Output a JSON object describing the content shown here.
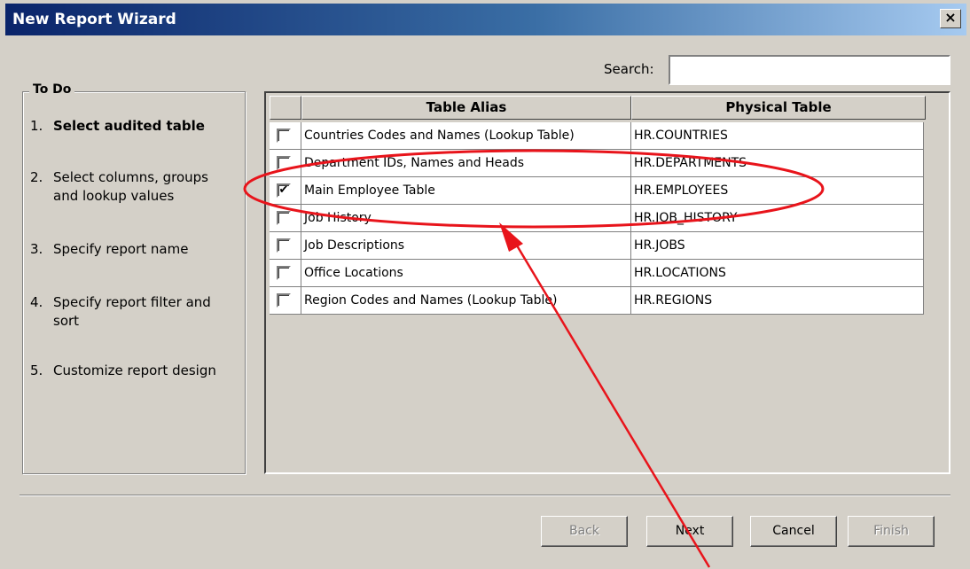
{
  "window": {
    "title": "New Report Wizard",
    "close_glyph": "×"
  },
  "search": {
    "label": "Search:",
    "value": "",
    "placeholder": ""
  },
  "todo": {
    "title": "To Do",
    "steps": [
      {
        "num": "1.",
        "label": "Select audited table",
        "active": true
      },
      {
        "num": "2.",
        "label": "Select columns, groups and lookup values",
        "active": false
      },
      {
        "num": "3.",
        "label": "Specify report name",
        "active": false
      },
      {
        "num": "4.",
        "label": "Specify report filter and sort",
        "active": false
      },
      {
        "num": "5.",
        "label": "Customize report design",
        "active": false
      }
    ]
  },
  "table": {
    "columns": [
      "Table Alias",
      "Physical Table"
    ],
    "rows": [
      {
        "checked": false,
        "alias": "Countries Codes and Names (Lookup Table)",
        "physical": "HR.COUNTRIES"
      },
      {
        "checked": false,
        "alias": "Department IDs, Names and Heads",
        "physical": "HR.DEPARTMENTS"
      },
      {
        "checked": true,
        "alias": "Main Employee Table",
        "physical": "HR.EMPLOYEES"
      },
      {
        "checked": false,
        "alias": "Job History",
        "physical": "HR.JOB_HISTORY"
      },
      {
        "checked": false,
        "alias": "Job Descriptions",
        "physical": "HR.JOBS"
      },
      {
        "checked": false,
        "alias": "Office Locations",
        "physical": "HR.LOCATIONS"
      },
      {
        "checked": false,
        "alias": "Region Codes and Names (Lookup Table)",
        "physical": "HR.REGIONS"
      }
    ]
  },
  "buttons": {
    "back": {
      "label": "Back",
      "enabled": false
    },
    "next": {
      "label": "Next",
      "enabled": true
    },
    "cancel": {
      "label": "Cancel",
      "enabled": true
    },
    "finish": {
      "label": "Finish",
      "enabled": false
    }
  },
  "checkmark_glyph": "✔",
  "annotation": {
    "color": "#e8141b",
    "icon": "red-ellipse-and-arrow"
  }
}
